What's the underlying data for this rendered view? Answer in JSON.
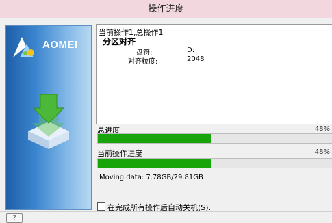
{
  "window": {
    "title": "操作进度"
  },
  "brand": {
    "name": "AOMEI"
  },
  "info": {
    "line1": "当前操作1,总操作1",
    "line2": "分区对齐",
    "rows": [
      {
        "label": "盘符:",
        "value": "D:"
      },
      {
        "label": "对齐粒度:",
        "value": "2048"
      }
    ]
  },
  "total_progress": {
    "label": "总进度",
    "percent_text": "48%",
    "value": 0.48
  },
  "current_progress": {
    "label": "当前操作进度",
    "percent_text": "48%",
    "value": 0.48
  },
  "moving_data": "Moving data: 7.78GB/29.81GB",
  "shutdown_option": {
    "label": "在完成所有操作后自动关机(S).",
    "checked": false
  },
  "help": {
    "glyph": "?"
  },
  "colors": {
    "progress": "#18a50a",
    "title_bar": "#f3d7de",
    "side_panel": "#2f76c3"
  }
}
